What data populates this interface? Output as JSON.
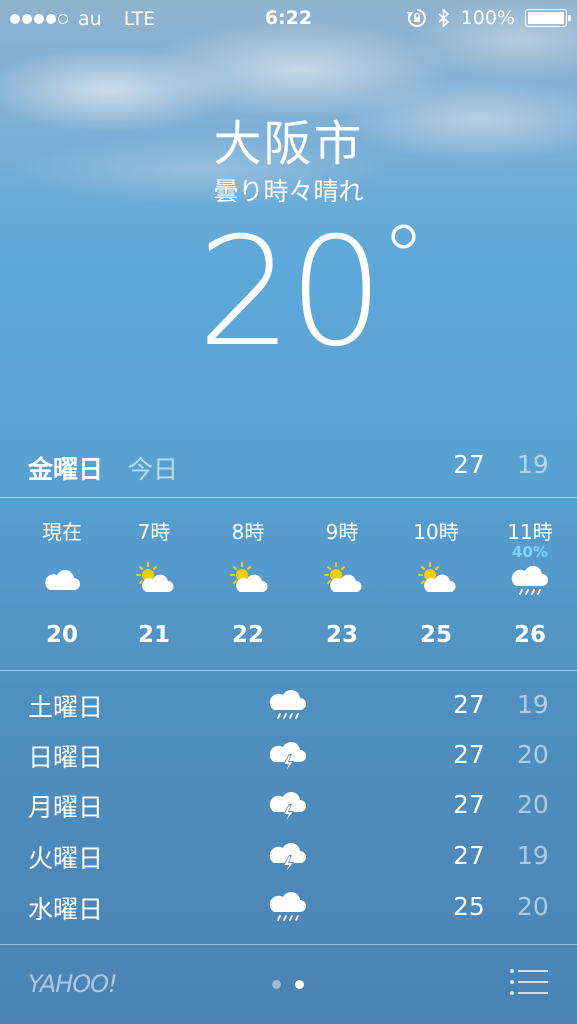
{
  "status_bar": {
    "signal_filled": 4,
    "signal_total": 5,
    "carrier": "au",
    "network": "LTE",
    "time": "6:22",
    "battery": "100%",
    "icons": [
      "rotation-lock-icon",
      "bluetooth-icon",
      "battery-icon"
    ]
  },
  "location": {
    "city": "大阪市",
    "condition": "曇り時々晴れ",
    "temperature": "20",
    "degree": "°"
  },
  "today": {
    "day": "金曜日",
    "label": "今日",
    "high": "27",
    "low": "19"
  },
  "hourly": [
    {
      "time": "現在",
      "icon": "cloud-icon",
      "temp": "20",
      "pop": ""
    },
    {
      "time": "7時",
      "icon": "partly-sunny-icon",
      "temp": "21",
      "pop": ""
    },
    {
      "time": "8時",
      "icon": "partly-sunny-icon",
      "temp": "22",
      "pop": ""
    },
    {
      "time": "9時",
      "icon": "partly-sunny-icon",
      "temp": "23",
      "pop": ""
    },
    {
      "time": "10時",
      "icon": "partly-sunny-icon",
      "temp": "25",
      "pop": ""
    },
    {
      "time": "11時",
      "icon": "rain-icon",
      "temp": "26",
      "pop": "40%"
    }
  ],
  "daily": [
    {
      "day": "土曜日",
      "icon": "rain-icon",
      "high": "27",
      "low": "19"
    },
    {
      "day": "日曜日",
      "icon": "thunderstorm-icon",
      "high": "27",
      "low": "20"
    },
    {
      "day": "月曜日",
      "icon": "thunderstorm-icon",
      "high": "27",
      "low": "20"
    },
    {
      "day": "火曜日",
      "icon": "thunderstorm-icon",
      "high": "27",
      "low": "19"
    },
    {
      "day": "水曜日",
      "icon": "rain-icon",
      "high": "25",
      "low": "20"
    }
  ],
  "footer": {
    "brand": "YAHOO!",
    "pages": 2,
    "active_page": 2,
    "menu_icon": "list-icon"
  },
  "colors": {
    "pop_text": "#7fd4ff",
    "sun": "#f5d000"
  }
}
